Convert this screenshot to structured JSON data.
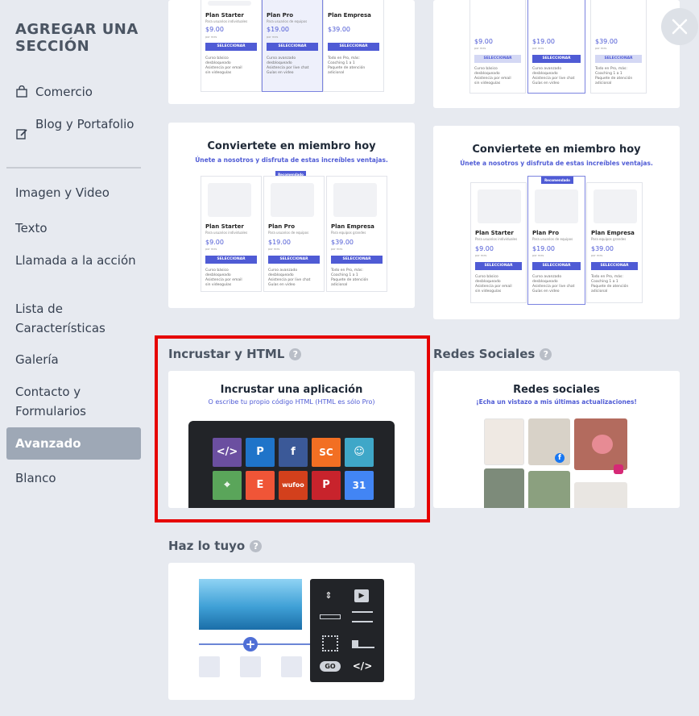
{
  "sidebar": {
    "title": "AGREGAR UNA SECCIÓN",
    "items": [
      {
        "label": "Comercio"
      },
      {
        "label": "Blog y Portafolio"
      },
      {
        "label": "Imagen y Video"
      },
      {
        "label": "Texto"
      },
      {
        "label": "Llamada a la acción"
      },
      {
        "label": "Lista de Características"
      },
      {
        "label": "Galería"
      },
      {
        "label": "Contacto y Formularios"
      },
      {
        "label": "Avanzado"
      },
      {
        "label": "Blanco"
      }
    ]
  },
  "sections": {
    "embed": {
      "heading": "Incrustar y HTML",
      "card_title": "Incrustar una aplicación",
      "card_subtitle": "O escribe tu propio código HTML (HTML es sólo Pro)"
    },
    "social": {
      "heading": "Redes Sociales",
      "card_title": "Redes sociales",
      "card_subtitle": "¡Echa un vistazo a mis últimas actualizaciones!"
    },
    "custom": {
      "heading": "Haz lo tuyo",
      "go_label": "GO",
      "code_label": "</>"
    }
  },
  "pricing": {
    "title": "Conviertete en miembro hoy",
    "subtitle": "Únete a nosotros y disfruta de estas increíbles ventajas.",
    "recommended": "Recomendado",
    "per_month": "por mes",
    "button": "SELECCIONAR",
    "plans": [
      {
        "name": "Plan Starter",
        "desc": "Para usuarios individuales",
        "price": "$9.00",
        "f1": "Curso básico",
        "f2": "desbloqueado",
        "f3": "Asistencia por email",
        "f4": "sin videoguías"
      },
      {
        "name": "Plan Pro",
        "desc": "Para usuarios de equipos",
        "price": "$19.00",
        "f1": "Curso avanzado",
        "f2": "desbloqueado",
        "f3": "Asistencia por live chat",
        "f4": "Guías en video"
      },
      {
        "name": "Plan Empresa",
        "desc": "Para equipos grandes",
        "price": "$39.00",
        "f1": "Todo en Pro, más:",
        "f2": "Coaching 1 a 1",
        "f3": "Paquete de atención",
        "f4": "adicional"
      }
    ]
  },
  "app_tiles": [
    {
      "icon": "code-icon",
      "text": "</>",
      "color": "#6b4fa0"
    },
    {
      "icon": "paypal-icon",
      "text": "P",
      "color": "#1f74c9"
    },
    {
      "icon": "facebook-icon",
      "text": "f",
      "color": "#3b5998"
    },
    {
      "icon": "soundcloud-icon",
      "text": "SC",
      "color": "#f26f23"
    },
    {
      "icon": "mailchimp-icon",
      "text": "☺",
      "color": "#3fa7c8"
    },
    {
      "icon": "maps-icon",
      "text": "⌖",
      "color": "#5aa55a"
    },
    {
      "icon": "eventbrite-icon",
      "text": "E",
      "color": "#f05537"
    },
    {
      "icon": "wufoo-icon",
      "text": "wufoo",
      "color": "#d3401c"
    },
    {
      "icon": "pinterest-icon",
      "text": "P",
      "color": "#c8232c"
    },
    {
      "icon": "calendar-icon",
      "text": "31",
      "color": "#4285f4"
    }
  ],
  "colors": {
    "accent": "#4f5bd5",
    "highlight": "#e60000",
    "sidebar_active": "#9ea8b6",
    "dark_panel": "#222428"
  }
}
